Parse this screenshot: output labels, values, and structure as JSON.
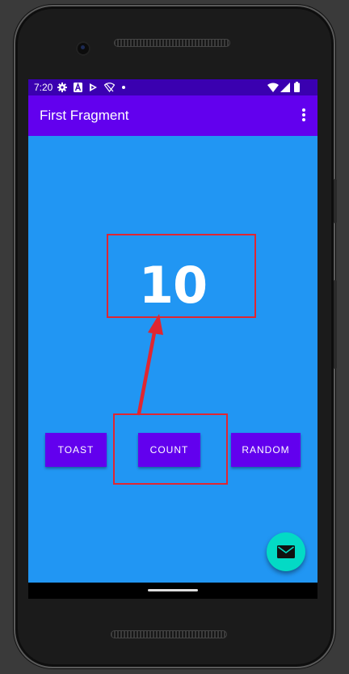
{
  "statusbar": {
    "time": "7:20",
    "icons_left": [
      "gear-icon",
      "a-icon",
      "play-icon",
      "wifi-slash-icon",
      "dot-icon"
    ],
    "icons_right": [
      "wifi-icon",
      "signal-icon",
      "battery-icon"
    ]
  },
  "appbar": {
    "title": "First Fragment",
    "menu_icon": "more-vert-icon"
  },
  "main": {
    "count_value": "10",
    "buttons": {
      "toast": "TOAST",
      "count": "COUNT",
      "random": "RANDOM"
    },
    "fab_icon": "email-icon"
  },
  "colors": {
    "statusbar": "#3a00b0",
    "appbar": "#6200ee",
    "background": "#2196f3",
    "button": "#6200ee",
    "fab": "#03dac5",
    "highlight": "#e02631"
  }
}
